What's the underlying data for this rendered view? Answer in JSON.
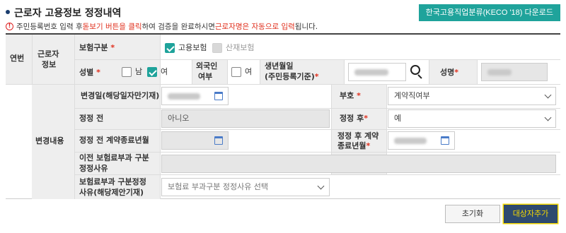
{
  "header": {
    "title": "근로자 고용정보 정정내역",
    "download_label": "한국고용직업분류(KECO '18) 다운로드"
  },
  "notice": {
    "part1": "주민등록번호 입력 후 ",
    "part2": "돋보기 버튼을 클릭",
    "part3": "하여 검증을 완료하시면 ",
    "part4": "근로자명은 자동으로 입력",
    "part5": "됩니다."
  },
  "form": {
    "serial_label": "연번",
    "worker_info_label_1": "근로자",
    "worker_info_label_2": "정보",
    "insurance_type_label": "보험구분",
    "insurance_options": [
      {
        "label": "고용보험",
        "checked": true,
        "disabled": false
      },
      {
        "label": "산재보험",
        "checked": false,
        "disabled": true
      }
    ],
    "gender_label": "성별",
    "gender_options": [
      {
        "label": "남",
        "checked": false
      },
      {
        "label": "여",
        "checked": true
      }
    ],
    "foreigner_label_1": "외국인",
    "foreigner_label_2": "여부",
    "foreigner_option": {
      "label": "여",
      "checked": false
    },
    "birth_label_1": "생년월일",
    "birth_label_2": "(주민등록기준)",
    "name_label": "성명",
    "change_content_label": "변경내용",
    "change_date_label": "변경일(해당일자만기재)",
    "code_label": "부호",
    "code_value": "계약직여부",
    "before_label": "정정 전",
    "before_value": "아니오",
    "after_label": "정정 후",
    "after_value": "예",
    "before_contract_end_label": "정정 전 계약종료년월",
    "after_contract_end_label_1": "정정 후 계약",
    "after_contract_end_label_2": "종료년월",
    "prev_reason_label_1": "이전 보험료부과 구분",
    "prev_reason_label_2": "정정사유",
    "reason_label_1": "보험료부과 구분정정",
    "reason_label_2": "사유(해당제안기재)",
    "reason_placeholder": "보험료 부과구분 정정사유 선택"
  },
  "actions": {
    "reset_label": "초기화",
    "add_label": "대상자추가"
  },
  "colors": {
    "accent": "#1fa39b",
    "primary": "#2e4a6f",
    "required": "#e0301e",
    "highlight_border": "#f5d800"
  }
}
